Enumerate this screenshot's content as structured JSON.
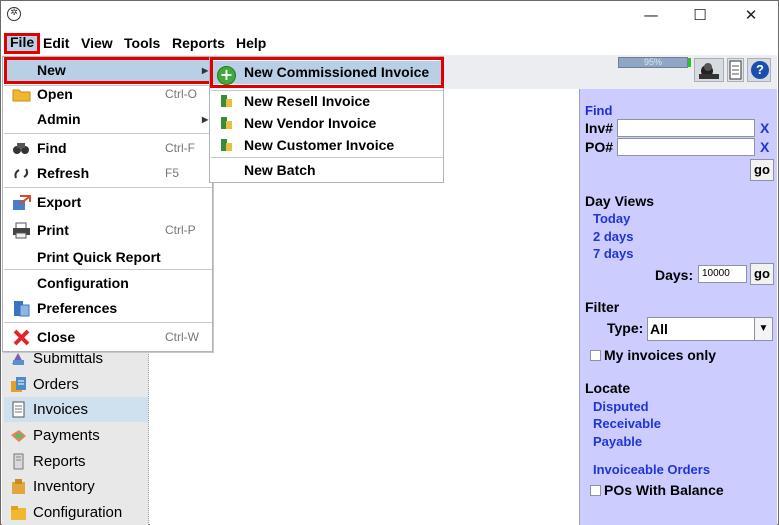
{
  "window": {
    "app_icon": "asterisk-circle-icon",
    "minimize_glyph": "—",
    "maximize_glyph": "☐",
    "close_glyph": "✕"
  },
  "menubar": {
    "items": [
      {
        "label": "File"
      },
      {
        "label": "Edit"
      },
      {
        "label": "View"
      },
      {
        "label": "Tools"
      },
      {
        "label": "Reports"
      },
      {
        "label": "Help"
      }
    ]
  },
  "toolbar": {
    "memory_label": "95%",
    "memory_percent": 95,
    "help_glyph": "?"
  },
  "file_menu": {
    "items": [
      {
        "label": "New",
        "accelerator": "",
        "icon": "",
        "submenu": true
      },
      {
        "label": "Open",
        "accelerator": "Ctrl-O",
        "icon": "folder-icon"
      },
      {
        "label": "Admin",
        "accelerator": "",
        "icon": "",
        "submenu": true
      },
      {
        "label": "Find",
        "accelerator": "Ctrl-F",
        "icon": "binoculars-icon"
      },
      {
        "label": "Refresh",
        "accelerator": "F5",
        "icon": "refresh-icon"
      },
      {
        "label": "Export",
        "accelerator": "",
        "icon": "export-icon"
      },
      {
        "label": "Print",
        "accelerator": "Ctrl-P",
        "icon": "printer-icon"
      },
      {
        "label": "Print Quick Report",
        "accelerator": "",
        "icon": ""
      },
      {
        "label": "Configuration",
        "accelerator": "",
        "icon": ""
      },
      {
        "label": "Preferences",
        "accelerator": "",
        "icon": "preferences-icon"
      },
      {
        "label": "Close",
        "accelerator": "Ctrl-W",
        "icon": "close-x-icon"
      }
    ],
    "submenu_arrow": "▶"
  },
  "new_submenu": {
    "items": [
      {
        "label": "New Commissioned Invoice",
        "icon": "add-circle-icon"
      },
      {
        "label": "New Resell Invoice",
        "icon": "invoice-icon"
      },
      {
        "label": "New Vendor Invoice",
        "icon": "invoice-icon"
      },
      {
        "label": "New Customer Invoice",
        "icon": "invoice-icon"
      },
      {
        "label": "New Batch",
        "icon": ""
      }
    ]
  },
  "left_nav": {
    "items": [
      {
        "label": "Submittals",
        "icon": "submittals-icon"
      },
      {
        "label": "Orders",
        "icon": "orders-icon"
      },
      {
        "label": "Invoices",
        "icon": "invoices-icon",
        "active": true
      },
      {
        "label": "Payments",
        "icon": "payments-icon"
      },
      {
        "label": "Reports",
        "icon": "reports-icon"
      },
      {
        "label": "Inventory",
        "icon": "inventory-icon"
      },
      {
        "label": "Configuration",
        "icon": "configuration-icon"
      }
    ]
  },
  "right_panel": {
    "find": {
      "heading": "Find",
      "inv_label": "Inv#",
      "inv_value": "",
      "po_label": "PO#",
      "po_value": "",
      "clear_glyph": "X",
      "go_label": "go"
    },
    "day_views": {
      "heading": "Day Views",
      "links": [
        "Today",
        "2 days",
        "7 days"
      ],
      "days_label": "Days:",
      "days_value": "10000",
      "go_label": "go"
    },
    "filter": {
      "heading": "Filter",
      "type_label": "Type:",
      "type_value": "All",
      "my_invoices_label": "My invoices only",
      "my_invoices_checked": false
    },
    "locate": {
      "heading": "Locate",
      "links": [
        "Disputed",
        "Receivable",
        "Payable"
      ],
      "invoiceable_label": "Invoiceable Orders",
      "pos_balance_label": "POs With Balance",
      "pos_balance_checked": false
    }
  }
}
